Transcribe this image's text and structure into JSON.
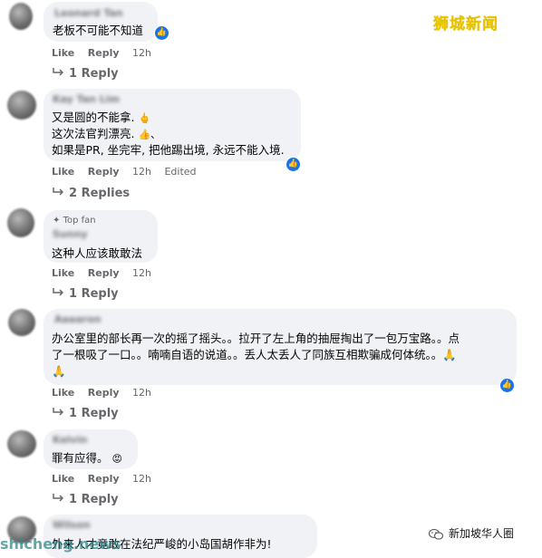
{
  "watermarks": {
    "top": "狮城新闻",
    "bottom": "shicheng.news",
    "wechat": "新加坡华人圈"
  },
  "actions": {
    "like": "Like",
    "reply": "Reply"
  },
  "comments": [
    {
      "author": "Leonard Tan",
      "lines": [
        "老板不可能不知道"
      ],
      "time": "12h",
      "edited": "",
      "replies": "1 Reply"
    },
    {
      "author": "Kay Tan Lim",
      "lines": [
        "又是圆的不能拿.",
        "这次法官判漂亮.",
        "如果是PR, 坐完牢, 把他踢出境, 永远不能入境."
      ],
      "emoji": [
        "🖕",
        "👍、"
      ],
      "time": "12h",
      "edited": "Edited",
      "replies": "2 Replies"
    },
    {
      "author": "Sunny",
      "badge": "Top fan",
      "lines": [
        "这种人应该敢敢法"
      ],
      "time": "12h",
      "edited": "",
      "replies": "1 Reply"
    },
    {
      "author": "Aaaaron",
      "lines": [
        "办公室里的部长再一次的摇了摇头。。拉开了左上角的抽屉掏出了一包万宝路。。点",
        "了一根吸了一口。。喃喃自语的说道。。丢人太丢人了同族互相欺骗成何体统。。🙏",
        "🙏"
      ],
      "time": "12h",
      "edited": "",
      "replies": "1 Reply"
    },
    {
      "author": "Kelvin",
      "lines": [
        "罪有应得。"
      ],
      "emoji": [
        "😡"
      ],
      "time": "12h",
      "edited": "",
      "replies": "1 Reply"
    },
    {
      "author": "Wilson",
      "lines": [
        "外来人才竟敢在法纪严峻的小岛国胡作非为!"
      ]
    }
  ]
}
